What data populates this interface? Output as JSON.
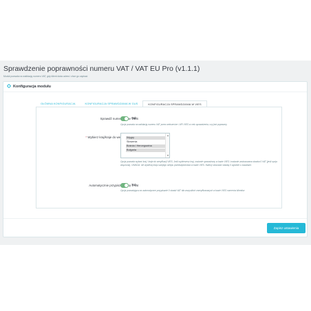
{
  "page": {
    "title": "Sprawdzenie poprawności numeru VAT / VAT EU Pro (v1.1.1)",
    "subtitle": "Moduł pozwala na walidację numeru VAT, gdy klient doda adres i chce go zapisać"
  },
  "panel": {
    "title": "Konfiguracja modułu",
    "icon": "gear-icon"
  },
  "tabs": [
    {
      "label": "GŁÓWNA KONFIGURACJA",
      "active": false
    },
    {
      "label": "KONFIGURACJA SPRAWDZANIA W GUS",
      "active": false
    },
    {
      "label": "KONFIGURACJA SPRAWDZANIA W VIES",
      "active": true
    }
  ],
  "fields": {
    "check_vies": {
      "label": "Sprawdź numer VAT w VIES",
      "switch_value": "Tak",
      "help": "Opcja pozwala na walidację numeru VAT przez webservice / API VIES w celu sprawdzenia, czy jest poprawny"
    },
    "countries": {
      "required_mark": "*",
      "label": "Wybierz kraj/kraje do weryfikacji VIES",
      "options": [
        "Węgry",
        "Słowenia",
        "Bośnia i Hercegowina",
        "Bułgaria"
      ],
      "selected": [
        "Węgry",
        "Bośnia i Hercegowina",
        "Bułgaria"
      ],
      "help": "Opcja pozwala wybrać kraj / kraje do weryfikacji VIES. Jeśli wybierzesz kraj, zostanie sprawdzony w bazie VIES i zostanie zastosowana stawka 0 VAT (jeśli opcja włączona). UWAGA: nie wybieraj kraju swojego sklepu przedsiębiorstwa w bazie VIES. Należy stosować stawkę 0 zgodnie z zasadami."
    },
    "auto_zero": {
      "label": "Automatycznie przypisz stawkę 0 vat",
      "switch_value": "Tak",
      "help": "Opcja pozwalająca na automatyczne przypisanie 0 stawki VAT dla wszystkich zweryfikowanych w bazie VIES numerów klientów"
    }
  },
  "actions": {
    "save_label": "Zapisz ustawienia"
  },
  "colors": {
    "accent": "#25b9d7",
    "switch_on": "#70b580",
    "background": "#eff1f2"
  }
}
